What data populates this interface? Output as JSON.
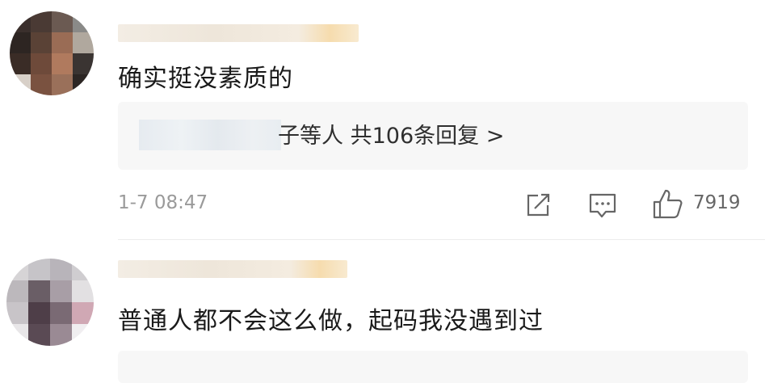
{
  "comments": [
    {
      "text": "确实挺没素质的",
      "reply_summary": "子等人 共106条回复 >",
      "time": "1-7 08:47",
      "likes": "7919"
    },
    {
      "text": "普通人都不会这么做，起码我没遇到过"
    }
  ],
  "icons": [
    "share-icon",
    "comment-icon",
    "like-icon"
  ],
  "colors": {
    "background": "#ffffff",
    "reply_box": "#f7f7f7",
    "meta_text": "#9a9a9a"
  }
}
